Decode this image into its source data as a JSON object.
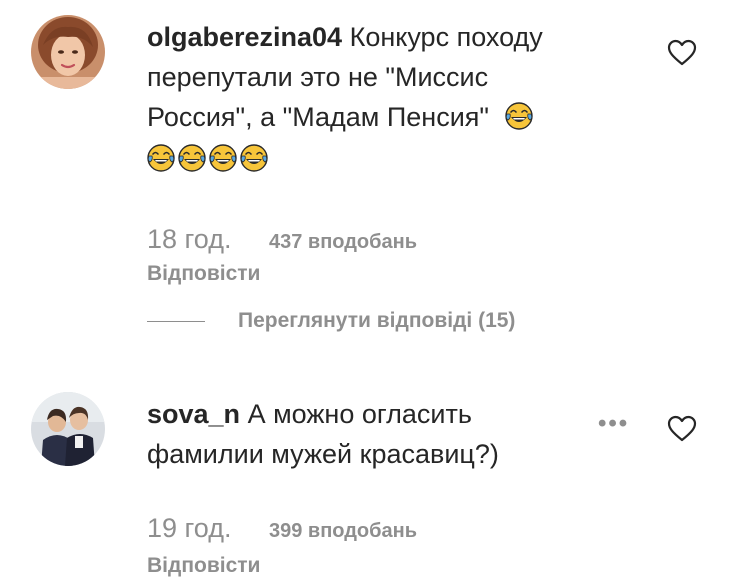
{
  "comments": [
    {
      "username": "olgaberezina04",
      "text_line1": "Конкурс походу",
      "text_line2": "перепутали это не \"Миссис",
      "text_line3": "Россия\", а \"Мадам Пенсия\"",
      "time": "18 год.",
      "likes": "437 вподобань",
      "reply": "Відповісти",
      "view_replies": "Переглянути відповіді (15)",
      "avatar_icon": "avatar-woman-photo"
    },
    {
      "username": "sova_n",
      "text_line1": "А можно огласить",
      "text_line2": "фамилии мужей красавиц?)",
      "time": "19 год.",
      "likes": "399 вподобань",
      "reply": "Відповісти",
      "more_label": "•••",
      "avatar_icon": "avatar-couple-photo"
    }
  ],
  "icons": {
    "heart": "heart-outline-icon",
    "emoji": "tears-of-joy-emoji",
    "more": "more-options-icon"
  },
  "colors": {
    "text": "#262626",
    "secondary": "#8e8e8e",
    "emoji_face": "#f7c53a",
    "emoji_tear": "#5aa8e0"
  }
}
